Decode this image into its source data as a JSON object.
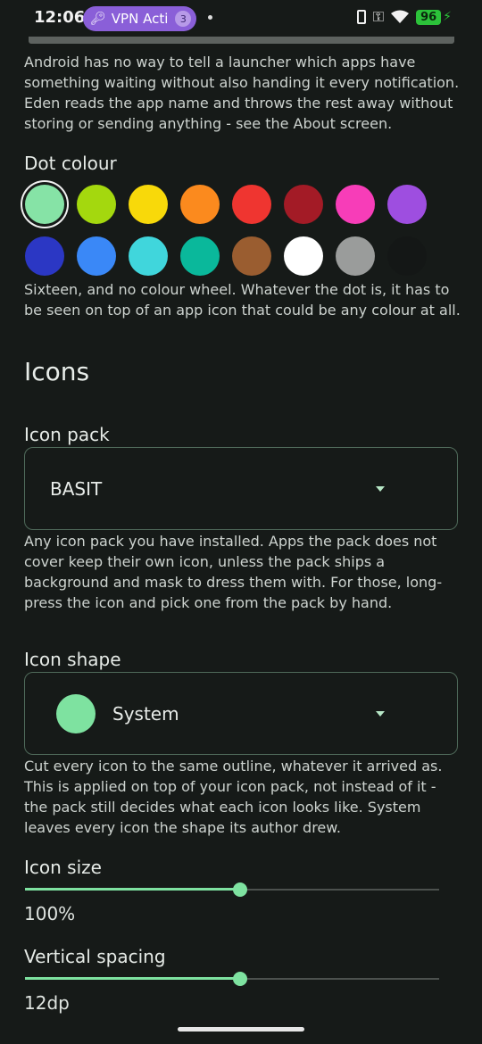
{
  "status_bar": {
    "time": "12:06",
    "vpn_label": "VPN Acti",
    "vpn_badge": "3",
    "battery": "96",
    "icons": [
      "key-icon",
      "phone-icon",
      "wifi-icon",
      "battery-icon",
      "charging-icon"
    ]
  },
  "notifications_help": "Android has no way to tell a launcher which apps have something waiting without also handing it every notification. Eden reads the app name and throws the rest away without storing or sending anything - see the About screen.",
  "dot_colour": {
    "label": "Dot colour",
    "selected_index": 0,
    "colors": [
      "#86e3a6",
      "#a4d80e",
      "#f8d90a",
      "#fb8a1e",
      "#ef3530",
      "#a31b26",
      "#f73db8",
      "#9e4ee0",
      "#2b37c4",
      "#3a88f7",
      "#40d6dc",
      "#0ab89b",
      "#9a5d30",
      "#ffffff",
      "#9a9c9b",
      "#141716"
    ],
    "help": "Sixteen, and no colour wheel. Whatever the dot is, it has to be seen on top of an app icon that could be any colour at all."
  },
  "icons_section": {
    "title": "Icons",
    "icon_pack": {
      "label": "Icon pack",
      "value": "BASIT",
      "help": "Any icon pack you have installed. Apps the pack does not cover keep their own icon, unless the pack ships a background and mask to dress them with. For those, long-press the icon and pick one from the pack by hand."
    },
    "icon_shape": {
      "label": "Icon shape",
      "value": "System",
      "swatch_color": "#7ee2a0",
      "help": "Cut every icon to the same outline, whatever it arrived as. This is applied on top of your icon pack, not instead of it - the pack still decides what each icon looks like. System leaves every icon the shape its author drew."
    },
    "icon_size": {
      "label": "Icon size",
      "value_text": "100%",
      "fraction": 0.52
    },
    "vertical_spacing": {
      "label": "Vertical spacing",
      "value_text": "12dp",
      "fraction": 0.52
    }
  }
}
